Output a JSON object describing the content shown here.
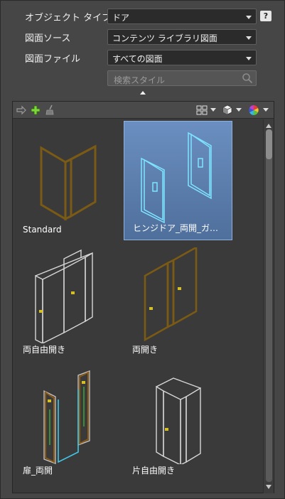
{
  "filters": {
    "object_type_label": "オブジェクト タイプ",
    "object_type_value": "ドア",
    "source_label": "図面ソース",
    "source_value": "コンテンツ ライブラリ図面",
    "file_label": "図面ファイル",
    "file_value": "すべての図面",
    "search_placeholder": "検索スタイル",
    "help_label": "?"
  },
  "toolbar": {
    "icons": [
      "import-arrow-icon",
      "add-plus-icon",
      "purge-brush-icon",
      "view-tiles-icon",
      "visual-style-cube-icon",
      "color-wheel-icon"
    ]
  },
  "styles": [
    {
      "name": "Standard",
      "selected": false,
      "color": "#7a5a14"
    },
    {
      "name": "ヒンジドア_両開_ガ…",
      "selected": true,
      "color": "#7fe0ff"
    },
    {
      "name": "両自由開き",
      "selected": false,
      "color": "#d8d8d8"
    },
    {
      "name": "両開き",
      "selected": false,
      "color": "#7a5a14"
    },
    {
      "name": "扉_両開",
      "selected": false,
      "color": "#d8d8d8"
    },
    {
      "name": "片自由開き",
      "selected": false,
      "color": "#d8d8d8"
    }
  ]
}
